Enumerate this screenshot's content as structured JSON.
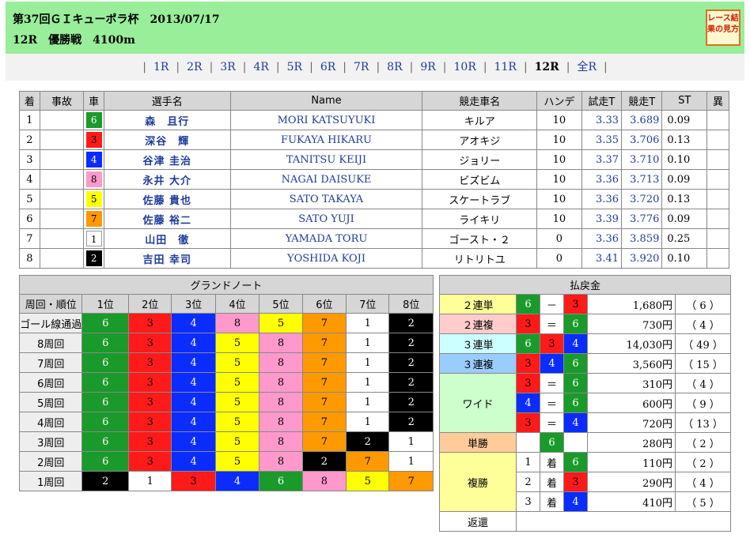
{
  "header": {
    "line1": "第37回ＧＩキューポラ杯　2013/07/17",
    "line2": "12R　優勝戦　4100m",
    "guide_button": "レース結果の見方"
  },
  "nav": {
    "items": [
      "1R",
      "2R",
      "3R",
      "4R",
      "5R",
      "6R",
      "7R",
      "8R",
      "9R",
      "10R",
      "11R",
      "12R",
      "全R"
    ],
    "current": "12R"
  },
  "colors": {
    "1": {
      "bg": "#ffffff",
      "fg": "#000000"
    },
    "2": {
      "bg": "#000000",
      "fg": "#ffffff"
    },
    "3": {
      "bg": "#ff1a1a",
      "fg": "#000000"
    },
    "4": {
      "bg": "#0a2cff",
      "fg": "#ffffff"
    },
    "5": {
      "bg": "#ffff00",
      "fg": "#000000"
    },
    "6": {
      "bg": "#1a9a2a",
      "fg": "#ffffff"
    },
    "7": {
      "bg": "#ff9900",
      "fg": "#000000"
    },
    "8": {
      "bg": "#ff99cc",
      "fg": "#000000"
    }
  },
  "result": {
    "headers": [
      "着",
      "事故",
      "車",
      "選手名",
      "Name",
      "競走車名",
      "ハンデ",
      "試走T",
      "競走T",
      "ST",
      "異"
    ],
    "rows": [
      {
        "pos": "1",
        "accident": "",
        "car": "6",
        "name": "森　且行",
        "en": "MORI KATSUYUKI",
        "machine": "キルア",
        "handicap": "10",
        "trial": "3.33",
        "race": "3.689",
        "st": "0.09",
        "abn": ""
      },
      {
        "pos": "2",
        "accident": "",
        "car": "3",
        "name": "深谷　輝",
        "en": "FUKAYA HIKARU",
        "machine": "アオキジ",
        "handicap": "10",
        "trial": "3.35",
        "race": "3.706",
        "st": "0.13",
        "abn": ""
      },
      {
        "pos": "3",
        "accident": "",
        "car": "4",
        "name": "谷津 圭治",
        "en": "TANITSU KEIJI",
        "machine": "ジョリー",
        "handicap": "10",
        "trial": "3.37",
        "race": "3.710",
        "st": "0.10",
        "abn": ""
      },
      {
        "pos": "4",
        "accident": "",
        "car": "8",
        "name": "永井 大介",
        "en": "NAGAI DAISUKE",
        "machine": "ビズビム",
        "handicap": "10",
        "trial": "3.36",
        "race": "3.713",
        "st": "0.09",
        "abn": ""
      },
      {
        "pos": "5",
        "accident": "",
        "car": "5",
        "name": "佐藤 貴也",
        "en": "SATO TAKAYA",
        "machine": "スケートラブ",
        "handicap": "10",
        "trial": "3.36",
        "race": "3.720",
        "st": "0.13",
        "abn": ""
      },
      {
        "pos": "6",
        "accident": "",
        "car": "7",
        "name": "佐藤 裕二",
        "en": "SATO YUJI",
        "machine": "ライキリ",
        "handicap": "10",
        "trial": "3.39",
        "race": "3.776",
        "st": "0.09",
        "abn": ""
      },
      {
        "pos": "7",
        "accident": "",
        "car": "1",
        "name": "山田　徹",
        "en": "YAMADA TORU",
        "machine": "ゴースト・２",
        "handicap": "0",
        "trial": "3.36",
        "race": "3.859",
        "st": "0.25",
        "abn": ""
      },
      {
        "pos": "8",
        "accident": "",
        "car": "2",
        "name": "吉田 幸司",
        "en": "YOSHIDA KOJI",
        "machine": "リトリトユ",
        "handicap": "0",
        "trial": "3.41",
        "race": "3.920",
        "st": "0.10",
        "abn": ""
      }
    ]
  },
  "grand": {
    "title": "グランドノート",
    "headers": [
      "周回・順位",
      "1位",
      "2位",
      "3位",
      "4位",
      "5位",
      "6位",
      "7位",
      "8位"
    ],
    "rows": [
      {
        "label": "ゴール線通過",
        "cars": [
          "6",
          "3",
          "4",
          "8",
          "5",
          "7",
          "1",
          "2"
        ]
      },
      {
        "label": "8周回",
        "cars": [
          "6",
          "3",
          "4",
          "5",
          "8",
          "7",
          "1",
          "2"
        ]
      },
      {
        "label": "7周回",
        "cars": [
          "6",
          "3",
          "4",
          "5",
          "8",
          "7",
          "1",
          "2"
        ]
      },
      {
        "label": "6周回",
        "cars": [
          "6",
          "3",
          "4",
          "5",
          "8",
          "7",
          "1",
          "2"
        ]
      },
      {
        "label": "5周回",
        "cars": [
          "6",
          "3",
          "4",
          "5",
          "8",
          "7",
          "1",
          "2"
        ]
      },
      {
        "label": "4周回",
        "cars": [
          "6",
          "3",
          "4",
          "5",
          "8",
          "7",
          "1",
          "2"
        ]
      },
      {
        "label": "3周回",
        "cars": [
          "6",
          "3",
          "4",
          "5",
          "8",
          "7",
          "2",
          "1"
        ]
      },
      {
        "label": "2周回",
        "cars": [
          "6",
          "3",
          "4",
          "5",
          "8",
          "2",
          "7",
          "1"
        ]
      },
      {
        "label": "1周回",
        "cars": [
          "2",
          "1",
          "3",
          "4",
          "6",
          "8",
          "5",
          "7"
        ]
      }
    ]
  },
  "payout": {
    "title": "払戻金",
    "nirentan": {
      "label": "２連単",
      "c1": "6",
      "op": "－",
      "c2": "3",
      "amount": "1,680円",
      "pop": "（ 6 ）",
      "bg": "#ffff99"
    },
    "nirenpuku": {
      "label": "２連複",
      "c1": "3",
      "op": "＝",
      "c2": "6",
      "amount": "730円",
      "pop": "（ 4 ）",
      "bg": "#ffcccc"
    },
    "sanrentan": {
      "label": "３連単",
      "c1": "6",
      "c2": "3",
      "c3": "4",
      "amount": "14,030円",
      "pop": "（ 49 ）",
      "bg": "#ccffff"
    },
    "sanrenpuku": {
      "label": "３連複",
      "c1": "3",
      "c2": "4",
      "c3": "6",
      "amount": "3,560円",
      "pop": "（ 15 ）",
      "bg": "#99ccff"
    },
    "wide": {
      "label": "ワイド",
      "bg": "#ccffcc",
      "rows": [
        {
          "c1": "3",
          "op": "＝",
          "c2": "6",
          "amount": "310円",
          "pop": "（ 4 ）"
        },
        {
          "c1": "4",
          "op": "＝",
          "c2": "6",
          "amount": "600円",
          "pop": "（ 9 ）"
        },
        {
          "c1": "3",
          "op": "＝",
          "c2": "4",
          "amount": "720円",
          "pop": "（ 13 ）"
        }
      ]
    },
    "tansho": {
      "label": "単勝",
      "c1": "6",
      "amount": "280円",
      "pop": "（ 2 ）",
      "bg": "#ffcc99"
    },
    "fukusho": {
      "label": "複勝",
      "bg": "#ffff99",
      "rows": [
        {
          "rank": "1",
          "chaku": "着",
          "c1": "6",
          "amount": "110円",
          "pop": "（ 2 ）"
        },
        {
          "rank": "2",
          "chaku": "着",
          "c1": "3",
          "amount": "290円",
          "pop": "（ 4 ）"
        },
        {
          "rank": "3",
          "chaku": "着",
          "c1": "4",
          "amount": "410円",
          "pop": "（ 5 ）"
        }
      ]
    },
    "henkan": {
      "label": "返還",
      "value": ""
    }
  }
}
